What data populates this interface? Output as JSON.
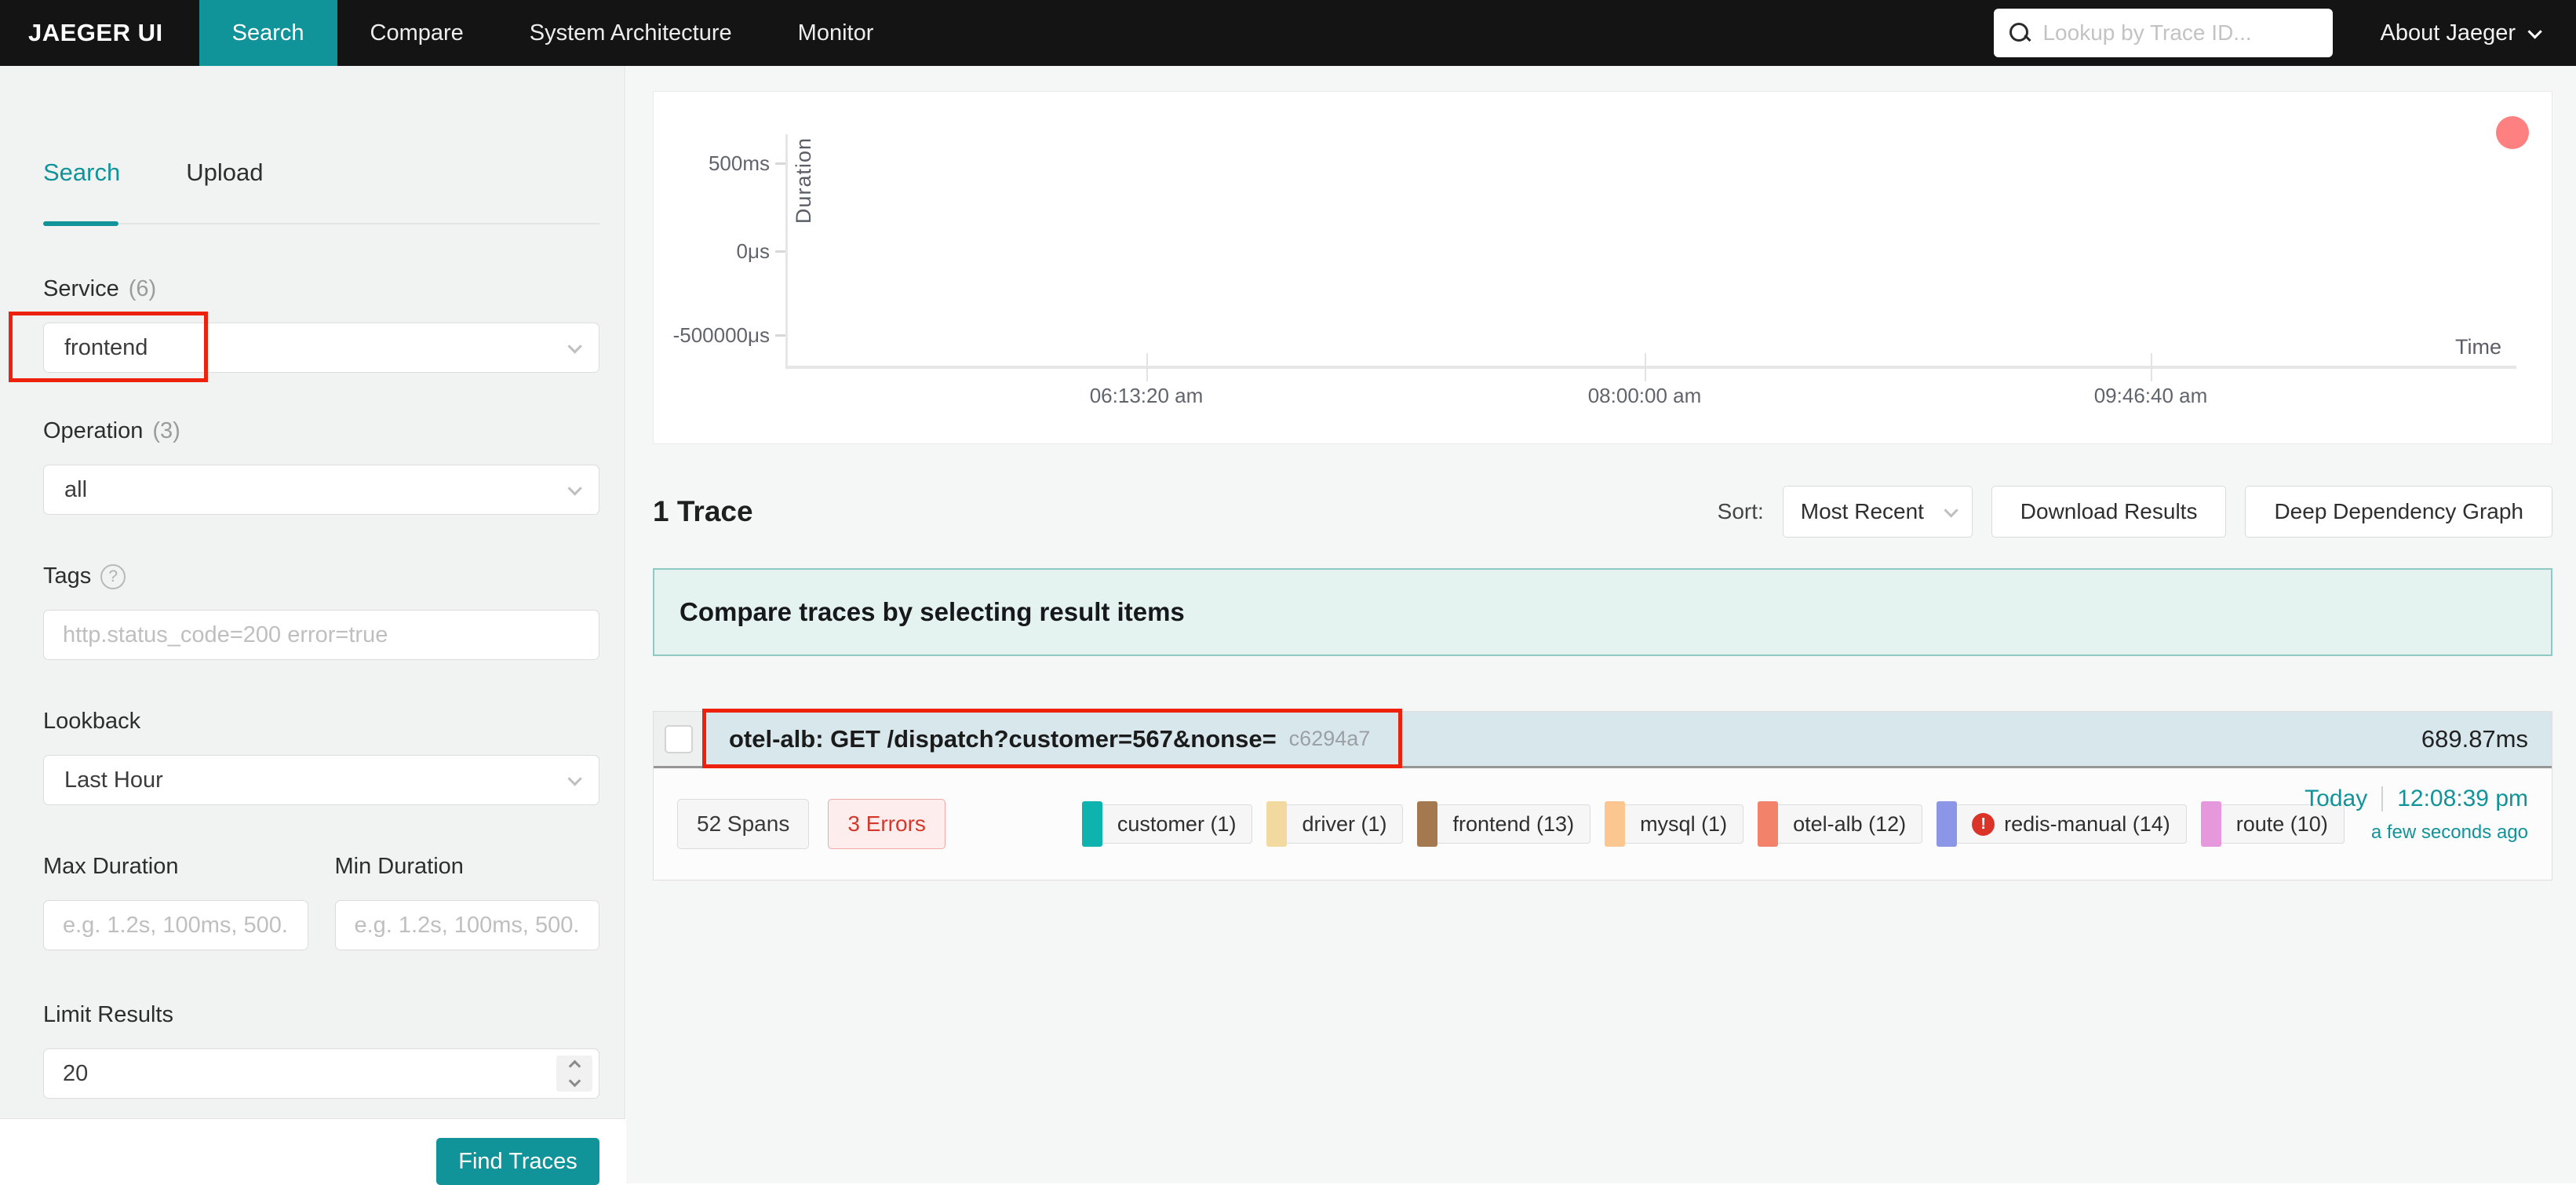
{
  "navbar": {
    "brand": "JAEGER UI",
    "items": [
      {
        "label": "Search",
        "active": true
      },
      {
        "label": "Compare",
        "active": false
      },
      {
        "label": "System Architecture",
        "active": false
      },
      {
        "label": "Monitor",
        "active": false
      }
    ],
    "lookup_placeholder": "Lookup by Trace ID...",
    "about_label": "About Jaeger"
  },
  "sidebar": {
    "tabs": [
      {
        "label": "Search",
        "active": true
      },
      {
        "label": "Upload",
        "active": false
      }
    ],
    "service": {
      "label": "Service",
      "count": "(6)",
      "value": "frontend"
    },
    "operation": {
      "label": "Operation",
      "count": "(3)",
      "value": "all"
    },
    "tags": {
      "label": "Tags",
      "placeholder": "http.status_code=200 error=true"
    },
    "lookback": {
      "label": "Lookback",
      "value": "Last Hour"
    },
    "max_duration": {
      "label": "Max Duration",
      "placeholder": "e.g. 1.2s, 100ms, 500..."
    },
    "min_duration": {
      "label": "Min Duration",
      "placeholder": "e.g. 1.2s, 100ms, 500..."
    },
    "limit": {
      "label": "Limit Results",
      "value": "20"
    },
    "find_traces_label": "Find Traces"
  },
  "chart_data": {
    "type": "scatter",
    "xlabel": "Time",
    "ylabel": "Duration",
    "x_ticks": [
      "06:13:20 am",
      "08:00:00 am",
      "09:46:40 am"
    ],
    "y_ticks": [
      "500ms",
      "0μs",
      "-500000μs"
    ],
    "grid": false,
    "points": [
      {
        "time": "12:08:39 pm",
        "duration": "689.87ms",
        "trace": "otel-alb: GET /dispatch?customer=567&nonse=",
        "color": "#ff8080"
      }
    ]
  },
  "results_header": {
    "count_label": "1 Trace",
    "sort_label": "Sort:",
    "sort_value": "Most Recent",
    "download_label": "Download Results",
    "ddg_label": "Deep Dependency Graph"
  },
  "compare_banner": "Compare traces by selecting result items",
  "trace": {
    "title": "otel-alb: GET /dispatch?customer=567&nonse=",
    "trace_id": "c6294a7",
    "duration": "689.87ms",
    "spans_badge": "52 Spans",
    "errors_badge": "3 Errors",
    "services": [
      {
        "name": "customer (1)",
        "color": "#0eb3ae",
        "error": false
      },
      {
        "name": "driver (1)",
        "color": "#f2d9a0",
        "error": false
      },
      {
        "name": "frontend (13)",
        "color": "#a5794f",
        "error": false
      },
      {
        "name": "mysql (1)",
        "color": "#fbc690",
        "error": false
      },
      {
        "name": "otel-alb (12)",
        "color": "#f2826a",
        "error": false
      },
      {
        "name": "redis-manual (14)",
        "color": "#8b97e6",
        "error": true
      },
      {
        "name": "route (10)",
        "color": "#e698dc",
        "error": false
      }
    ],
    "error_icon_glyph": "!",
    "date": "Today",
    "time": "12:08:39 pm",
    "ago": "a few seconds ago"
  },
  "colors": {
    "accent_teal": "#11939a",
    "navbar_bg": "#141414",
    "annotation_red": "#ee220c",
    "banner_bg": "#e4f2f0",
    "banner_border": "#8fc9c3",
    "trace_header_bg": "#d7e7ec",
    "scatter_point": "#ff8080",
    "error_red": "#dc3328"
  }
}
